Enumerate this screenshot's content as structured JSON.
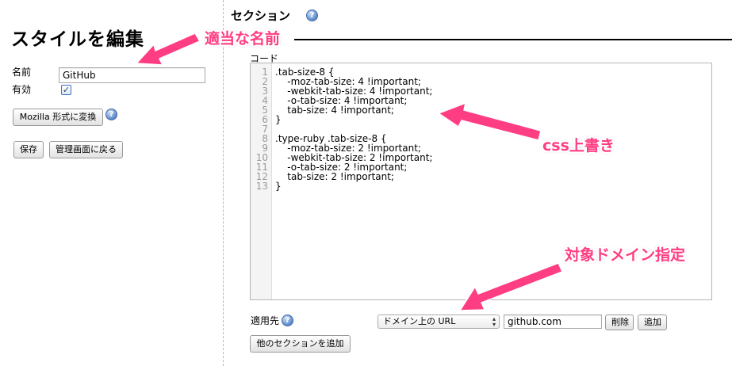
{
  "sidebar": {
    "title": "スタイルを編集",
    "name_label": "名前",
    "name_value": "GitHub",
    "enabled_label": "有効",
    "enabled_checked": "✓",
    "mozilla_button": "Mozilla 形式に変換",
    "help_glyph": "?",
    "save_button": "保存",
    "back_button": "管理画面に戻る"
  },
  "section": {
    "heading": "セクション",
    "code_label": "コード",
    "line_numbers": [
      "1",
      "2",
      "3",
      "4",
      "5",
      "6",
      "7",
      "8",
      "9",
      "10",
      "11",
      "12",
      "13"
    ],
    "code_lines": [
      ".tab-size-8 {",
      "    -moz-tab-size: 4 !important;",
      "    -webkit-tab-size: 4 !important;",
      "    -o-tab-size: 4 !important;",
      "    tab-size: 4 !important;",
      "}",
      "",
      ".type-ruby .tab-size-8 {",
      "    -moz-tab-size: 2 !important;",
      "    -webkit-tab-size: 2 !important;",
      "    -o-tab-size: 2 !important;",
      "    tab-size: 2 !important;",
      "}"
    ],
    "applies_to_label": "適用先",
    "applies_to_type": "ドメイン上の URL",
    "applies_to_value": "github.com",
    "delete_button": "削除",
    "add_button": "追加",
    "add_section_button": "他のセクションを追加"
  },
  "annotations": {
    "name_note": "適当な名前",
    "css_note": "css上書き",
    "domain_note": "対象ドメイン指定",
    "color": "#ff3d82"
  }
}
